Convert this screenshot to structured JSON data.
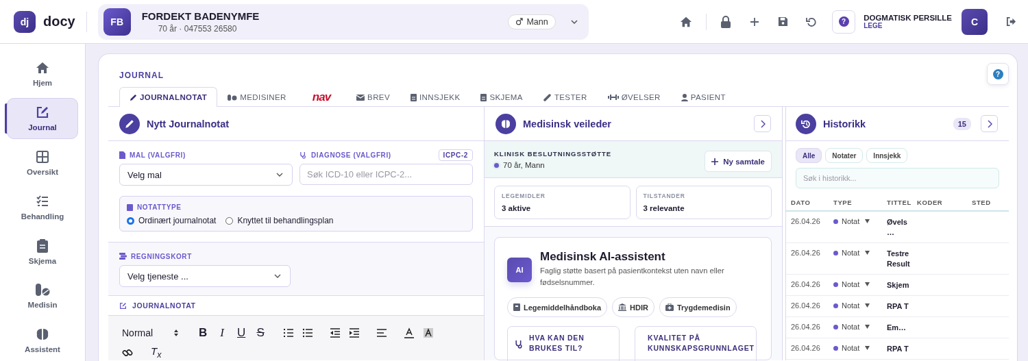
{
  "app": {
    "logo_mark": "dj",
    "logo_text": "docy"
  },
  "patient": {
    "initials": "FB",
    "name": "FORDEKT BADENYMFE",
    "details": "70 år · 047553 26580",
    "gender": "Mann"
  },
  "header": {
    "help": "?",
    "user_name": "DOGMATISK PERSILLE",
    "user_role": "LEGE",
    "user_initial": "C"
  },
  "sidebar": {
    "items": [
      {
        "label": "Hjem",
        "selected": false
      },
      {
        "label": "Journal",
        "selected": true
      },
      {
        "label": "Oversikt",
        "selected": false
      },
      {
        "label": "Behandling",
        "selected": false
      },
      {
        "label": "Skjema",
        "selected": false
      },
      {
        "label": "Medisin",
        "selected": false
      },
      {
        "label": "Assistent",
        "selected": false
      }
    ]
  },
  "journal": {
    "title": "JOURNAL",
    "help": "?",
    "tabs": [
      {
        "label": "JOURNALNOTAT",
        "kind": "text",
        "selected": true
      },
      {
        "label": "MEDISINER",
        "kind": "text",
        "selected": false
      },
      {
        "label": "nav",
        "kind": "logo",
        "selected": false
      },
      {
        "label": "BREV",
        "kind": "text",
        "selected": false
      },
      {
        "label": "INNSJEKK",
        "kind": "text",
        "selected": false
      },
      {
        "label": "SKJEMA",
        "kind": "text",
        "selected": false
      },
      {
        "label": "TESTER",
        "kind": "text",
        "selected": false
      },
      {
        "label": "ØVELSER",
        "kind": "text",
        "selected": false
      },
      {
        "label": "PASIENT",
        "kind": "text",
        "selected": false
      }
    ]
  },
  "note": {
    "title": "Nytt Journalnotat",
    "template": {
      "label": "MAL (VALGFRI)",
      "value": "Velg mal"
    },
    "diagnosis": {
      "label": "DIAGNOSE (VALGFRI)",
      "code_system": "ICPC-2",
      "placeholder": "Søk ICD-10 eller ICPC-2..."
    },
    "note_type": {
      "label": "NOTATTYPE",
      "options": [
        {
          "label": "Ordinært journalnotat",
          "selected": true
        },
        {
          "label": "Knyttet til behandlingsplan",
          "selected": false
        }
      ]
    },
    "billing": {
      "label": "REGNINGSKORT",
      "value": "Velg tjeneste ..."
    },
    "editor": {
      "label": "JOURNALNOTAT",
      "format": "Normal",
      "letters": [
        "B",
        "I",
        "U",
        "S"
      ],
      "clear": "T$_{x}$"
    }
  },
  "advisor": {
    "title": "Medisinsk veileder",
    "support": {
      "title": "KLINISK BESLUTNINGSSTØTTE",
      "patient": "70 år, Mann",
      "new_button": "Ny samtale"
    },
    "stats": [
      {
        "label": "LEGEMIDLER",
        "value": "3 aktive"
      },
      {
        "label": "TILSTANDER",
        "value": "3 relevante"
      }
    ],
    "assistant": {
      "badge": "AI",
      "title": "Medisinsk AI-assistent",
      "description": "Faglig støtte basert på pasientkontekst uten navn eller fødselsnummer.",
      "sources": [
        "Legemiddelhåndboka",
        "HDIR",
        "Trygdemedisin"
      ],
      "info_cards": [
        "HVA KAN DEN BRUKES TIL?",
        "KVALITET PÅ KUNNSKAPSGRUNNLAGET"
      ]
    }
  },
  "history": {
    "title": "Historikk",
    "count": "15",
    "filters": [
      {
        "label": "Alle",
        "selected": true
      },
      {
        "label": "Notater",
        "selected": false
      },
      {
        "label": "Innsjekk",
        "selected": false
      }
    ],
    "search": {
      "placeholder": "Søk i historikk..."
    },
    "columns": [
      "DATO",
      "TYPE",
      "TITTEL",
      "KODER",
      "STED"
    ],
    "rows": [
      {
        "date": "26.04.26",
        "type": "Notat",
        "title": [
          "Øvels",
          "…"
        ]
      },
      {
        "date": "26.04.26",
        "type": "Notat",
        "title": [
          "Testre",
          "Result"
        ]
      },
      {
        "date": "26.04.26",
        "type": "Notat",
        "title": [
          "Skjem"
        ]
      },
      {
        "date": "26.04.26",
        "type": "Notat",
        "title": [
          "RPA T"
        ]
      },
      {
        "date": "26.04.26",
        "type": "Notat",
        "title": [
          "Em…"
        ]
      },
      {
        "date": "26.04.26",
        "type": "Notat",
        "title": [
          "RPA T"
        ]
      }
    ]
  }
}
